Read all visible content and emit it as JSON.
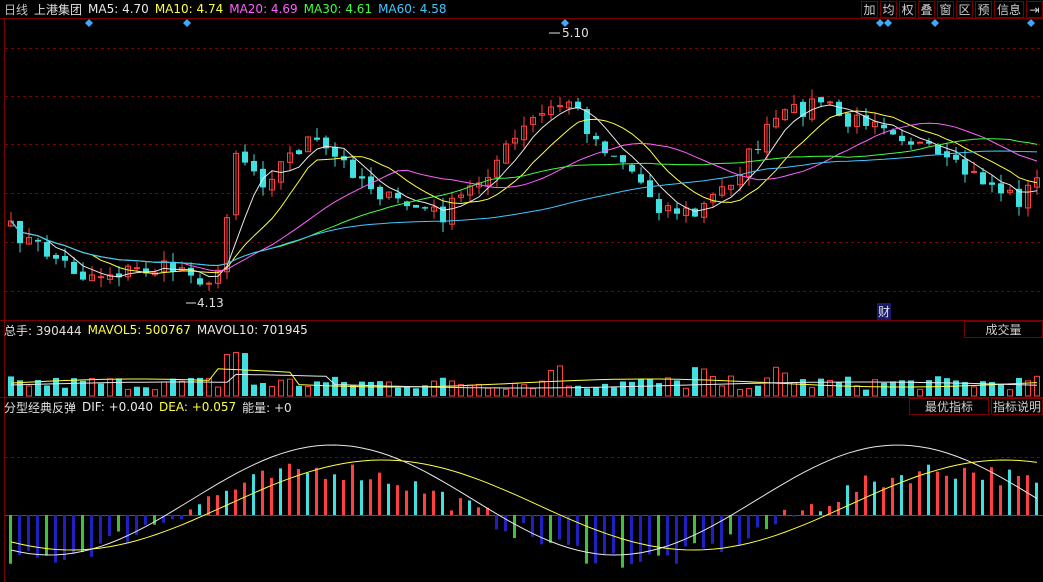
{
  "header": {
    "period": "日线",
    "stock_name": "上港集团",
    "ma5": "MA5: 4.70",
    "ma10": "MA10: 4.74",
    "ma20": "MA20: 4.69",
    "ma30": "MA30: 4.61",
    "ma60": "MA60: 4.58"
  },
  "toolbar": [
    "加",
    "均",
    "权",
    "叠",
    "窗",
    "区",
    "预",
    "信息",
    "⇥"
  ],
  "main_chart": {
    "high_label": "5.10",
    "low_label": "4.13",
    "finance_marker": "财"
  },
  "volume_panel": {
    "total": "总手: 390444",
    "mavol5": "MAVOL5: 500767",
    "mavol10": "MAVOL10: 701945",
    "button": "成交量"
  },
  "indicator_panel": {
    "name": "分型经典反弹",
    "dif": "DIF: +0.040",
    "dea": "DEA: +0.057",
    "energy": "能量: +0",
    "best_button": "最优指标",
    "help_button": "指标说明"
  },
  "colors": {
    "up": "#ff4040",
    "down": "#40e0e0",
    "ma5": "#e8e8e8",
    "ma10": "#ffff40",
    "ma20": "#ff60ff",
    "ma30": "#40ff40",
    "ma60": "#40c8ff",
    "frame": "#7a0000"
  }
}
